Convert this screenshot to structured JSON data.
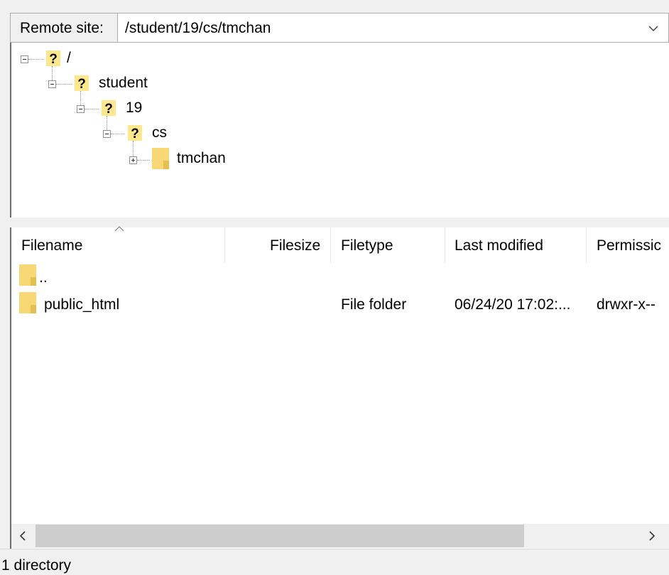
{
  "remote_site": {
    "label": "Remote site:",
    "path": "/student/19/cs/tmchan"
  },
  "tree": {
    "nodes": [
      {
        "label": "/",
        "icon": "unknown-folder-icon",
        "expanded": true
      },
      {
        "label": "student",
        "icon": "unknown-folder-icon",
        "expanded": true
      },
      {
        "label": "19",
        "icon": "unknown-folder-icon",
        "expanded": true
      },
      {
        "label": "cs",
        "icon": "unknown-folder-icon",
        "expanded": true
      },
      {
        "label": "tmchan",
        "icon": "folder-icon",
        "expanded": false
      }
    ]
  },
  "columns": {
    "filename": "Filename",
    "filesize": "Filesize",
    "filetype": "Filetype",
    "last_modified": "Last modified",
    "permissions": "Permissic"
  },
  "rows": [
    {
      "filename": "..",
      "filesize": "",
      "filetype": "",
      "last_modified": "",
      "permissions": ""
    },
    {
      "filename": "public_html",
      "filesize": "",
      "filetype": "File folder",
      "last_modified": "06/24/20 17:02:...",
      "permissions": "drwxr-x--"
    }
  ],
  "status": {
    "text": "1 directory"
  },
  "colors": {
    "folder": "#f8d775",
    "question_bg": "#ffe88c",
    "scroll_thumb": "#cdcdcd"
  }
}
